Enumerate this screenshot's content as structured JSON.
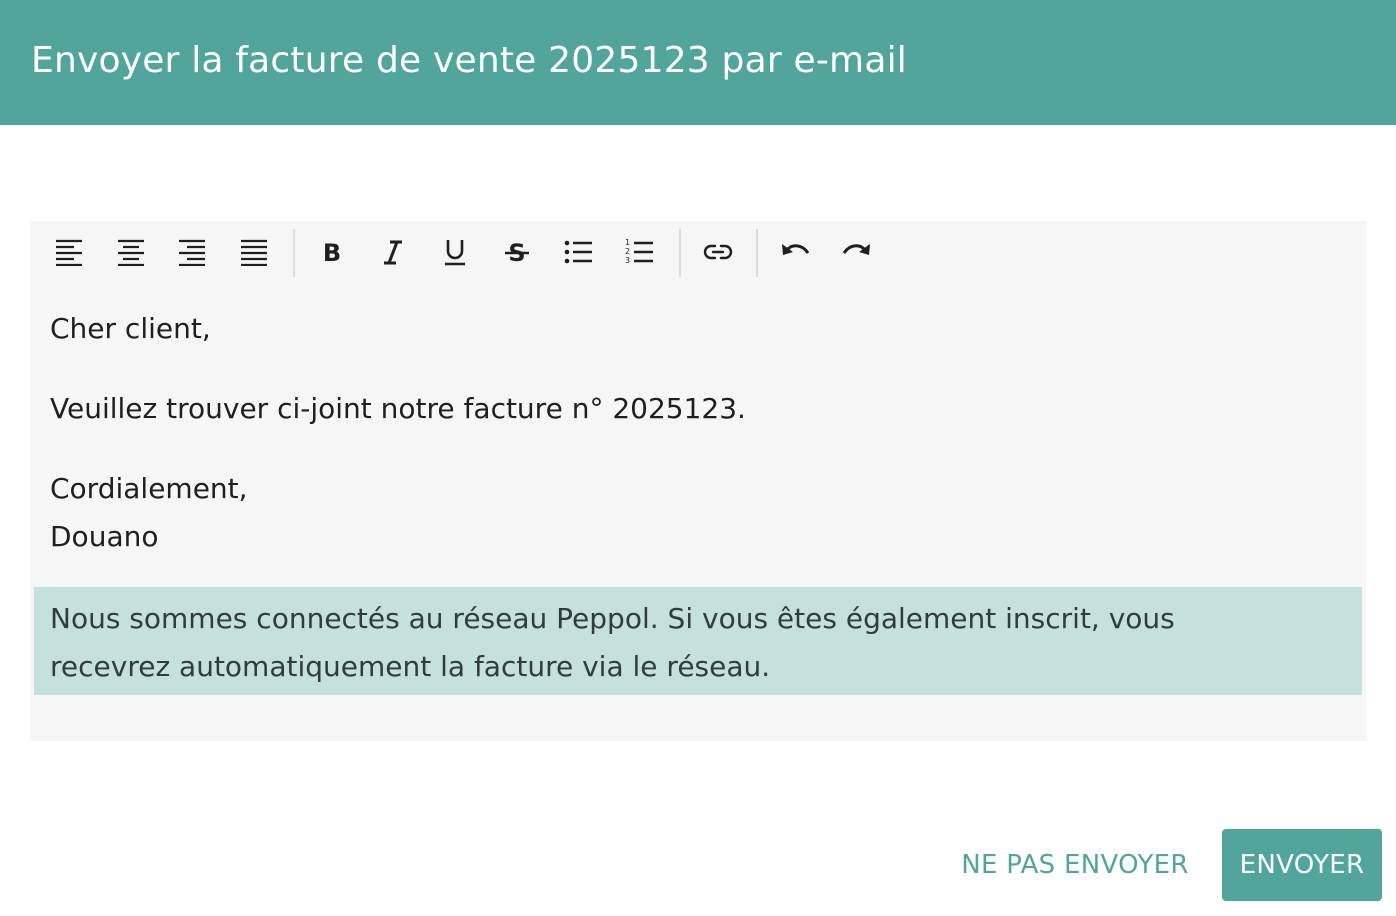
{
  "dialog": {
    "title": "Envoyer la facture de vente 2025123 par e-mail"
  },
  "toolbar": {
    "buttons": [
      {
        "name": "align-left-icon"
      },
      {
        "name": "align-center-icon"
      },
      {
        "name": "align-right-icon"
      },
      {
        "name": "align-justify-icon"
      },
      {
        "name": "bold-icon"
      },
      {
        "name": "italic-icon"
      },
      {
        "name": "underline-icon"
      },
      {
        "name": "strikethrough-icon"
      },
      {
        "name": "bulleted-list-icon"
      },
      {
        "name": "numbered-list-icon"
      },
      {
        "name": "link-icon"
      },
      {
        "name": "undo-icon"
      },
      {
        "name": "redo-icon"
      }
    ]
  },
  "editor": {
    "greeting": "Cher client,",
    "body": "Veuillez trouver ci-joint notre facture n° 2025123.",
    "closing": "Cordialement,",
    "signature": "Douano",
    "notice_line1": "Nous sommes connectés au réseau Peppol. Si vous êtes également inscrit, vous",
    "notice_line2": "recevrez automatiquement la facture via le réseau."
  },
  "actions": {
    "secondary_label": "NE PAS ENVOYER",
    "primary_label": "ENVOYER"
  },
  "colors": {
    "accent": "#52a59b",
    "notice_background": "#c5e1dd",
    "editor_background": "#f6f6f6"
  }
}
